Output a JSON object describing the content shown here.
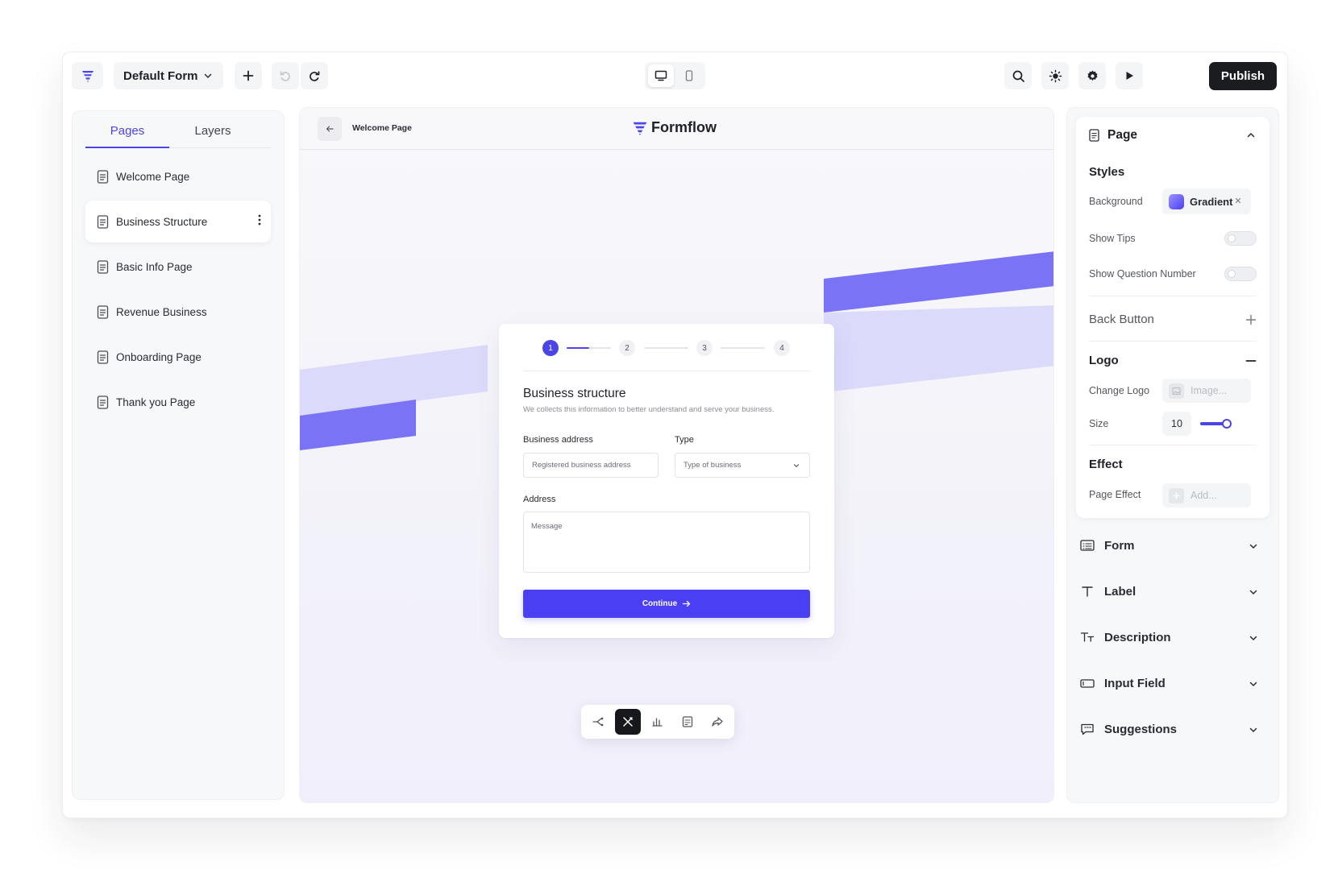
{
  "topbar": {
    "form_name": "Default Form",
    "publish_label": "Publish",
    "device_active": "desktop"
  },
  "left_panel": {
    "tabs": [
      {
        "label": "Pages",
        "active": true
      },
      {
        "label": "Layers",
        "active": false
      }
    ],
    "pages": [
      {
        "label": "Welcome Page",
        "active": false
      },
      {
        "label": "Business Structure",
        "active": true
      },
      {
        "label": "Basic Info Page",
        "active": false
      },
      {
        "label": "Revenue Business",
        "active": false
      },
      {
        "label": "Onboarding Page",
        "active": false
      },
      {
        "label": "Thank you Page",
        "active": false
      }
    ]
  },
  "canvas": {
    "current_page": "Welcome Page",
    "brand_name": "Formflow",
    "form": {
      "steps": [
        "1",
        "2",
        "3",
        "4"
      ],
      "active_step": 1,
      "step_progress": 0.5,
      "title": "Business structure",
      "subtitle": "We collects this information to better understand and serve your business.",
      "business_address_label": "Business address",
      "business_address_placeholder": "Registered business address",
      "type_label": "Type",
      "type_placeholder": "Type of business",
      "address_label": "Address",
      "address_placeholder": "Message",
      "continue_label": "Continue"
    },
    "dock_active": "design"
  },
  "right_panel": {
    "page_header": "Page",
    "styles_title": "Styles",
    "background_label": "Background",
    "background_value": "Gradient",
    "show_tips_label": "Show Tips",
    "show_tips": false,
    "show_question_number_label": "Show Question Number",
    "show_question_number": false,
    "back_button_label": "Back Button",
    "logo_title": "Logo",
    "change_logo_label": "Change Logo",
    "change_logo_placeholder": "Image...",
    "size_label": "Size",
    "size_value": "10",
    "effect_title": "Effect",
    "page_effect_label": "Page Effect",
    "page_effect_placeholder": "Add...",
    "accordions": [
      "Form",
      "Label",
      "Description",
      "Input Field",
      "Suggestions"
    ]
  },
  "colors": {
    "accent": "#4b44e6",
    "primary_button": "#4b3ff3",
    "dark": "#1b1c20",
    "band_light": "#dcdafb",
    "band_dark": "#7b73f6"
  }
}
